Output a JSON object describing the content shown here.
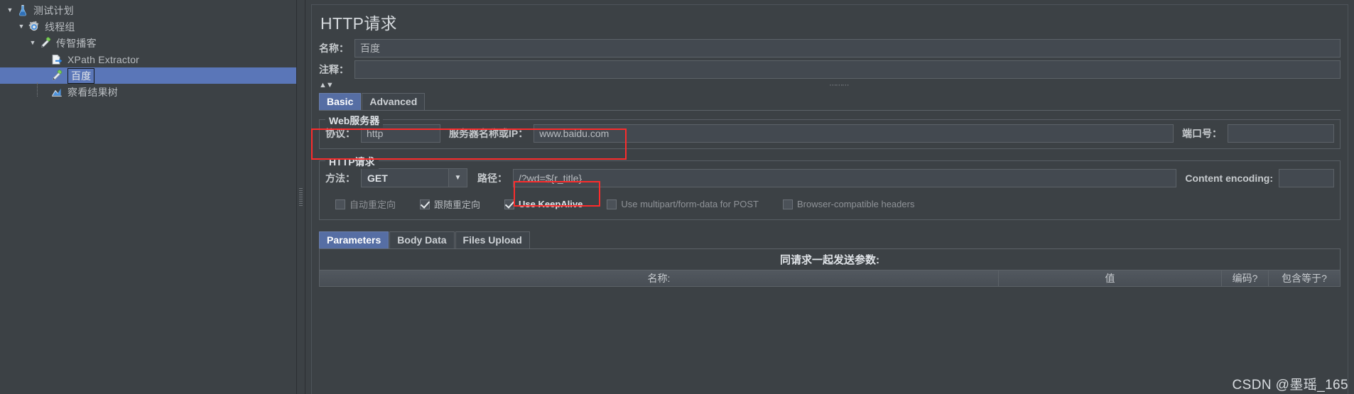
{
  "tree": {
    "items": [
      {
        "label": "测试计划",
        "icon": "flask-icon",
        "depth": 0,
        "expanded": true,
        "selected": false
      },
      {
        "label": "线程组",
        "icon": "gear-icon",
        "depth": 1,
        "expanded": true,
        "selected": false
      },
      {
        "label": "传智播客",
        "icon": "pipette-icon",
        "depth": 2,
        "expanded": true,
        "selected": false
      },
      {
        "label": "XPath Extractor",
        "icon": "document-arrow-icon",
        "depth": 3,
        "expanded": null,
        "selected": false
      },
      {
        "label": "百度",
        "icon": "pipette-icon",
        "depth": 3,
        "expanded": null,
        "selected": true
      },
      {
        "label": "察看结果树",
        "icon": "chart-icon",
        "depth": 3,
        "expanded": null,
        "selected": false
      }
    ]
  },
  "panel": {
    "title": "HTTP请求",
    "name_label": "名称：",
    "name_value": "百度",
    "comment_label": "注释：",
    "comment_value": "",
    "collapse_arrows": "▲▼",
    "splitter_dots": "⋯⋯⋯"
  },
  "tabs": {
    "items": [
      {
        "label": "Basic",
        "active": true
      },
      {
        "label": "Advanced",
        "active": false
      }
    ]
  },
  "web_server": {
    "group_title": "Web服务器",
    "protocol_label": "协议：",
    "protocol_value": "http",
    "server_label": "服务器名称或IP：",
    "server_value": "www.baidu.com",
    "port_label": "端口号：",
    "port_value": ""
  },
  "http_request": {
    "group_title": "HTTP请求",
    "method_label": "方法：",
    "method_value": "GET",
    "path_label": "路径：",
    "path_value": "/?wd=${r_title}",
    "content_encoding_label": "Content encoding:",
    "content_encoding_value": "",
    "checkboxes": [
      {
        "label": "自动重定向",
        "checked": false,
        "dim": true
      },
      {
        "label": "跟随重定向",
        "checked": true,
        "dim": false
      },
      {
        "label": "Use KeepAlive",
        "checked": true,
        "dim": false,
        "strong": true
      },
      {
        "label": "Use multipart/form-data for POST",
        "checked": false,
        "dim": true
      },
      {
        "label": "Browser-compatible headers",
        "checked": false,
        "dim": true
      }
    ]
  },
  "param_tabs": {
    "items": [
      {
        "label": "Parameters",
        "active": true
      },
      {
        "label": "Body Data",
        "active": false
      },
      {
        "label": "Files Upload",
        "active": false
      }
    ]
  },
  "param_table": {
    "banner": "同请求一起发送参数:",
    "columns": [
      "名称:",
      "值",
      "编码?",
      "包含等于?"
    ],
    "rows": []
  },
  "watermark": {
    "text": "CSDN @墨瑶_165"
  },
  "colors": {
    "selection_blue": "#5a76b8",
    "tab_active_blue": "#566ea4",
    "annotation_red": "#fc2c2c",
    "panel_bg": "#3c4145",
    "field_bg": "#434950",
    "border": "#5c6268"
  }
}
